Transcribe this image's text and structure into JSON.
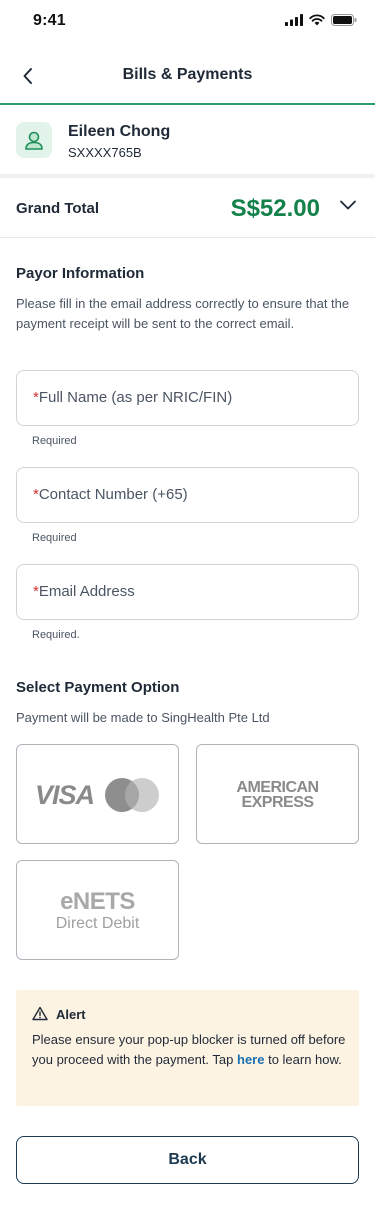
{
  "status_bar": {
    "time": "9:41"
  },
  "nav": {
    "title": "Bills & Payments"
  },
  "patient": {
    "name": "Eileen Chong",
    "id": "SXXXX765B"
  },
  "total": {
    "label": "Grand Total",
    "amount": "S$52.00"
  },
  "payor": {
    "title": "Payor Information",
    "description": "Please fill in the email address correctly to ensure that the payment receipt will be sent to the correct email.",
    "fields": [
      {
        "required_mark": "*",
        "placeholder": "Full Name (as per NRIC/FIN)",
        "helper": "Required"
      },
      {
        "required_mark": "*",
        "placeholder": "Contact Number (+65)",
        "helper": "Required"
      },
      {
        "required_mark": "*",
        "placeholder": "Email Address",
        "helper": "Required."
      }
    ]
  },
  "payment": {
    "title": "Select Payment Option",
    "description": "Payment will be made to SingHealth Pte Ltd",
    "options": [
      {
        "label": "VISA"
      },
      {
        "label_line1": "AMERICAN",
        "label_line2": "EXPRESS"
      },
      {
        "label_line1": "eNETS",
        "label_line2": "Direct Debit"
      }
    ]
  },
  "alert": {
    "title": "Alert",
    "text_before": "Please ensure your pop-up blocker is turned off before you proceed with the payment. Tap ",
    "link": "here",
    "text_after": " to learn how."
  },
  "footer": {
    "back_label": "Back"
  },
  "colors": {
    "accent": "#2f9e6e",
    "amount": "#14804a",
    "link": "#1a6fb0",
    "alert_bg": "#fdf3e3",
    "button_border": "#1c3a4f"
  },
  "icons": [
    "back-chevron-icon",
    "user-icon",
    "chevron-down-icon",
    "warning-icon",
    "signal-icon",
    "wifi-icon",
    "battery-icon"
  ]
}
